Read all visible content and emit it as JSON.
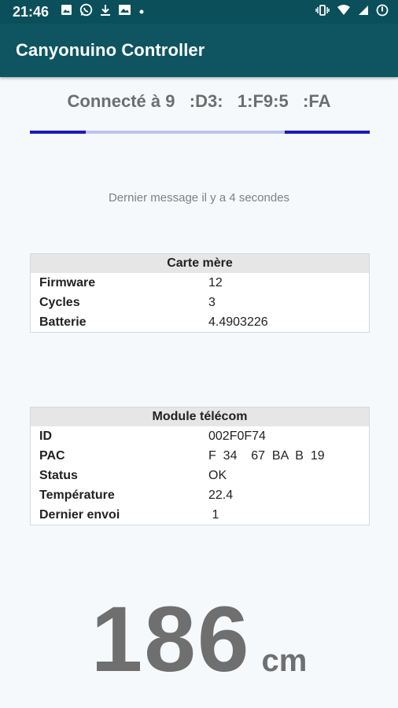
{
  "status_bar": {
    "time": "21:46",
    "icons_left": [
      "image-icon",
      "whatsapp-icon",
      "download-icon",
      "gallery-icon",
      "dot-icon"
    ],
    "icons_right": [
      "vibrate-icon",
      "wifi-icon",
      "signal-icon",
      "battery-icon"
    ]
  },
  "app_bar": {
    "title": "Canyonuino Controller"
  },
  "connection": {
    "text": "Connecté à 9   :D3:   1:F9:5   :FA",
    "progress_segments": [
      [
        0.0,
        0.165
      ],
      [
        0.75,
        1.0
      ]
    ]
  },
  "last_message": "Dernier message il y a 4 secondes",
  "mainboard": {
    "title": "Carte mère",
    "rows": [
      {
        "key": "Firmware",
        "value": "12"
      },
      {
        "key": "Cycles",
        "value": "3"
      },
      {
        "key": "Batterie",
        "value": "4.4903226"
      }
    ]
  },
  "telecom": {
    "title": "Module télécom",
    "rows": [
      {
        "key": "ID",
        "value": "002F0F74"
      },
      {
        "key": "PAC",
        "value": "F  34    67  BA  B  19"
      },
      {
        "key": "Status",
        "value": "OK"
      },
      {
        "key": "Température",
        "value": "22.4"
      },
      {
        "key": "Dernier envoi",
        "value": " 1"
      }
    ]
  },
  "measurement": {
    "value": "186",
    "unit": "cm"
  },
  "colors": {
    "status_bar": "#0b4f5a",
    "app_bar": "#0e5561",
    "progress_track": "#bfc3f0",
    "progress_fill": "#1a1ab8",
    "background": "#f5f9fc"
  }
}
